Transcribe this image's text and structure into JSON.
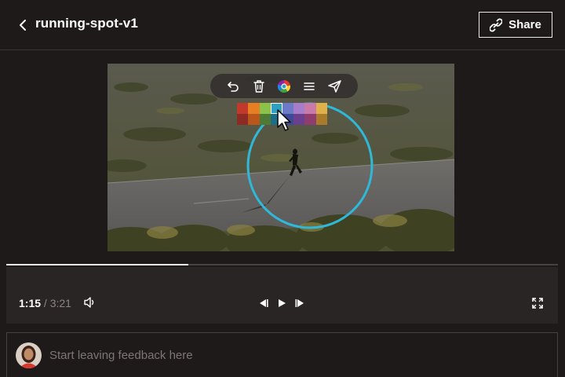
{
  "header": {
    "title": "running-spot-v1",
    "share_label": "Share",
    "back_icon": "chevron-left-icon",
    "share_icon": "link-icon"
  },
  "annotation_toolbar": {
    "tools": [
      "undo-icon",
      "trash-icon",
      "color-wheel-icon",
      "line-weight-icon",
      "send-icon"
    ],
    "palette": [
      "#c0392b",
      "#e67e22",
      "#8bc34a",
      "#2fa0c2",
      "#6c7ac8",
      "#a77cc8",
      "#c97aa8",
      "#e0b04a",
      "#8e2a24",
      "#b8561c",
      "#4f7a36",
      "#1c6d88",
      "#3e4a96",
      "#6a3f8e",
      "#8e3d6e",
      "#a97b2a"
    ],
    "selected_color": "#2fa0c2"
  },
  "player": {
    "current_time": "1:15",
    "separator": "/",
    "duration": "3:21",
    "progress": 0.33
  },
  "feedback": {
    "placeholder": "Start leaving feedback here"
  },
  "colors": {
    "background": "#1e1a1a",
    "annotation_circle": "#2fb8d8"
  }
}
